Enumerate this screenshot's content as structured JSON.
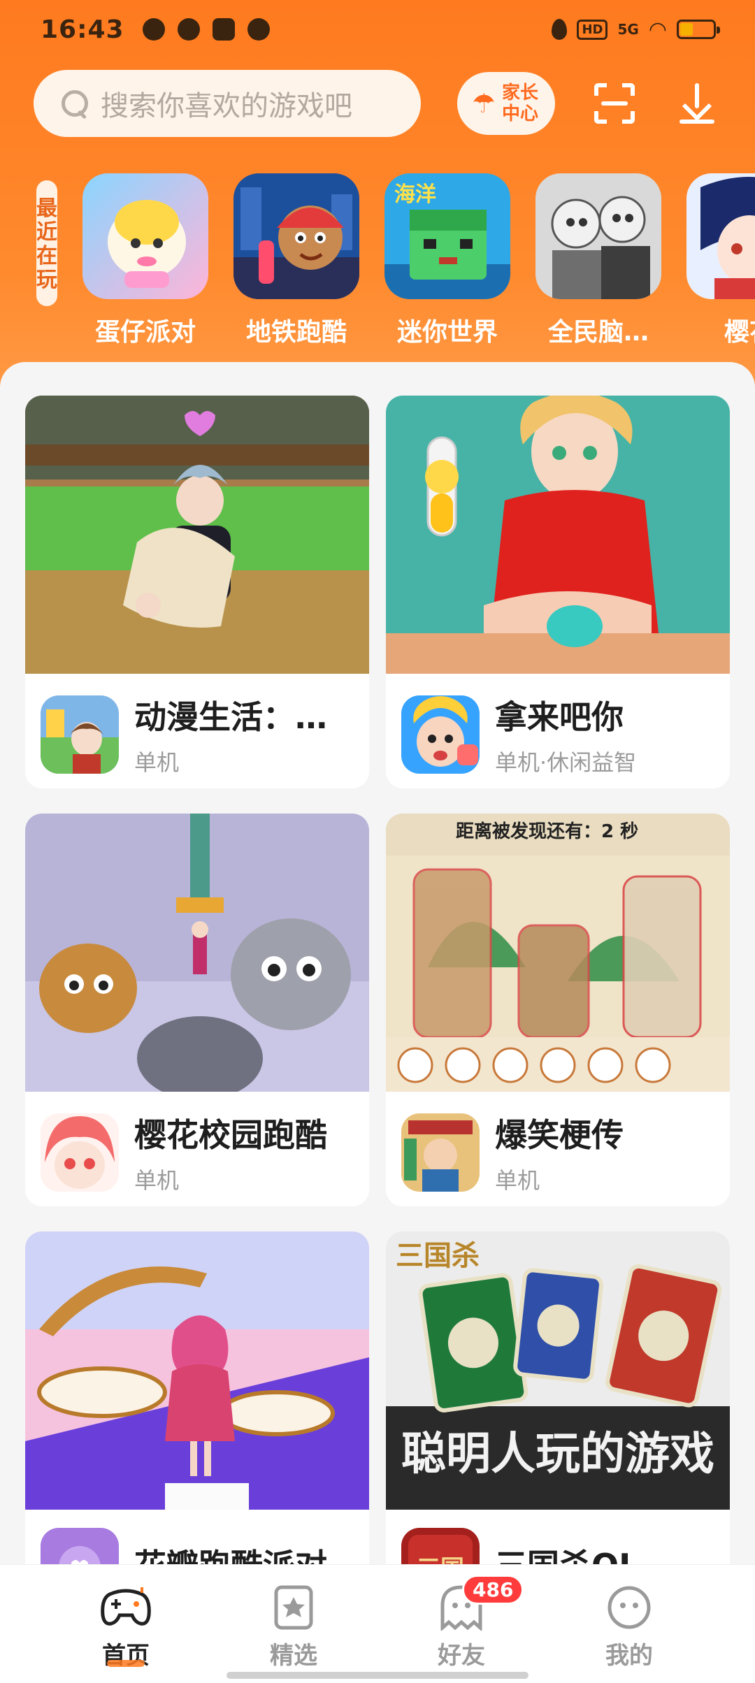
{
  "status_bar": {
    "time": "16:43",
    "network": "5G",
    "hd": "HD"
  },
  "search": {
    "placeholder": "搜索你喜欢的游戏吧"
  },
  "parent_center": {
    "label": "家长中心"
  },
  "recent": {
    "tag": "最近在玩",
    "items": [
      {
        "name": "蛋仔派对"
      },
      {
        "name": "地铁跑酷"
      },
      {
        "name": "迷你世界"
      },
      {
        "name": "全民脑…"
      },
      {
        "name": "樱花"
      }
    ]
  },
  "cards": [
    {
      "title": "动漫生活：…",
      "tags": "单机"
    },
    {
      "title": "拿来吧你",
      "tags": "单机·休闲益智"
    },
    {
      "title": "樱花校园跑酷",
      "tags": "单机"
    },
    {
      "title": "爆笑梗传",
      "tags": "单机",
      "overlay_text": "距离被发现还有：2 秒"
    },
    {
      "title": "花瓣跑酷派对",
      "tags": ""
    },
    {
      "title": "三国杀OL",
      "tags": "",
      "overlay_text": "聪明人玩的游戏"
    }
  ],
  "nav": {
    "items": [
      {
        "label": "首页",
        "icon": "gamepad-icon",
        "active": true
      },
      {
        "label": "精选",
        "icon": "star-bookmark-icon"
      },
      {
        "label": "好友",
        "icon": "ghost-icon",
        "badge": "486"
      },
      {
        "label": "我的",
        "icon": "smiley-icon"
      }
    ]
  },
  "colors": {
    "brand_orange": "#ff7a1f",
    "badge_red": "#ff3b3b"
  }
}
